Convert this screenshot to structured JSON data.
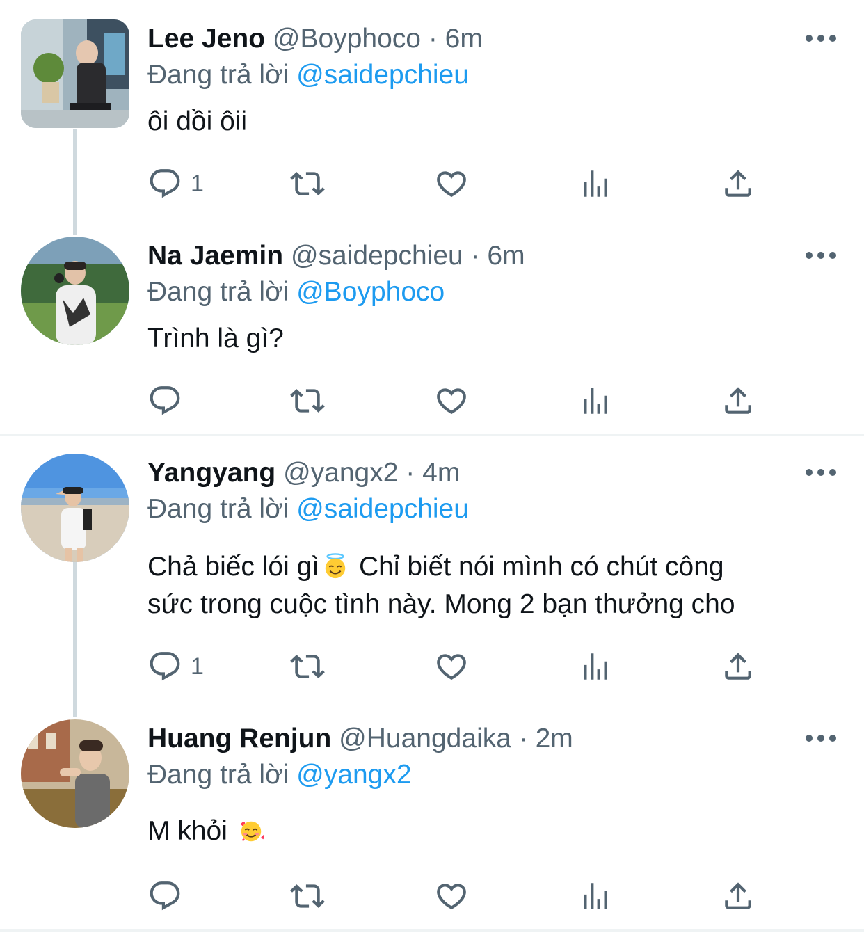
{
  "tweets": [
    {
      "name": "Lee Jeno",
      "handle": "@Boyphoco",
      "dot": "·",
      "time": "6m",
      "reply_prefix": "Đang trả lời",
      "reply_to": "@saidepchieu",
      "text": "ôi dồi ôii",
      "reply_count": "1",
      "avatar": "photo"
    },
    {
      "name": "Na Jaemin",
      "handle": "@saidepchieu",
      "dot": "·",
      "time": "6m",
      "reply_prefix": "Đang trả lời",
      "reply_to": "@Boyphoco",
      "text": "Trình là gì?",
      "reply_count": "",
      "avatar": "photo"
    },
    {
      "name": "Yangyang",
      "handle": "@yangx2",
      "dot": "·",
      "time": "4m",
      "reply_prefix": "Đang trả lời",
      "reply_to": "@saidepchieu",
      "text_part1": "Chả biếc lói gì",
      "text_part2": " Chỉ biết nói mình có chút công",
      "text_line2": "sức trong cuộc tình này. Mong 2 bạn thưởng cho",
      "emoji1": "smiling-face-with-halo",
      "reply_count": "1",
      "avatar": "photo"
    },
    {
      "name": "Huang Renjun",
      "handle": "@Huangdaika",
      "dot": "·",
      "time": "2m",
      "reply_prefix": "Đang trả lời",
      "reply_to": "@yangx2",
      "text": "M khỏi ",
      "emoji": "smiling-face-with-hearts",
      "reply_count": "",
      "avatar": "photo"
    }
  ],
  "colors": {
    "text": "#0f1419",
    "secondary": "#536471",
    "accent": "#1d9bf0",
    "thread_line": "#cfd9de",
    "separator": "#eff3f4"
  },
  "icons": [
    "reply-icon",
    "retweet-icon",
    "like-icon",
    "views-icon",
    "share-icon",
    "more-icon"
  ]
}
